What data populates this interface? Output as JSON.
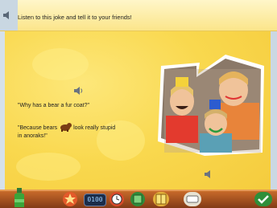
{
  "instruction": "Listen to this joke and tell it to your friends!",
  "joke": {
    "question": "\"Why has a bear a fur coat?\"",
    "answer_part1": "\"Because bears",
    "answer_part2": "look really stupid",
    "answer_part3": "in anoraks!\""
  },
  "counter": "0100",
  "colors": {
    "background": "#f9d84e",
    "topbar": "#fbe58a",
    "bottombar": "#9a4a1c",
    "accent_green": "#3aa53a"
  },
  "icons": [
    "speaker-icon",
    "bear-icon",
    "bottle-icon",
    "check-icon"
  ]
}
